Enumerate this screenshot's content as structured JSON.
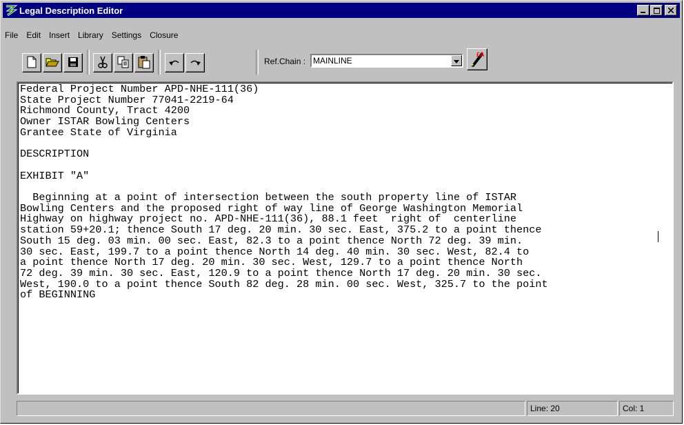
{
  "window": {
    "title": "Legal Description Editor"
  },
  "menu": [
    "File",
    "Edit",
    "Insert",
    "Library",
    "Settings",
    "Closure"
  ],
  "toolbar": {
    "buttons": [
      "new-file-icon",
      "open-folder-icon",
      "save-icon",
      "cut-icon",
      "copy-icon",
      "paste-icon",
      "undo-icon",
      "redo-icon"
    ],
    "ref_chain_label": "Ref.Chain :",
    "ref_chain_value": "MAINLINE",
    "run_button_icon": "pen-run-icon"
  },
  "editor": {
    "text": "Federal Project Number APD-NHE-111(36)\nState Project Number 77041-2219-64\nRichmond County, Tract 4200\nOwner ISTAR Bowling Centers\nGrantee State of Virginia\n\nDESCRIPTION\n\nEXHIBIT \"A\"\n\n  Beginning at a point of intersection between the south property line of ISTAR\nBowling Centers and the proposed right of way line of George Washington Memorial\nHighway on highway project no. APD-NHE-111(36), 88.1 feet  right of  centerline\nstation 59+20.1; thence South 17 deg. 20 min. 30 sec. East, 375.2 to a point thence\nSouth 15 deg. 03 min. 00 sec. East, 82.3 to a point thence North 72 deg. 39 min.\n30 sec. East, 199.7 to a point thence North 14 deg. 40 min. 30 sec. West, 82.4 to\na point thence North 17 deg. 20 min. 30 sec. West, 129.7 to a point thence North\n72 deg. 39 min. 30 sec. East, 120.9 to a point thence North 17 deg. 20 min. 30 sec.\nWest, 190.0 to a point thence South 82 deg. 28 min. 00 sec. West, 325.7 to the point\nof BEGINNING"
  },
  "status": {
    "line": "Line: 20",
    "col": "Col: 1"
  },
  "colors": {
    "titlebar": "#000080",
    "face": "#c0c0c0"
  }
}
